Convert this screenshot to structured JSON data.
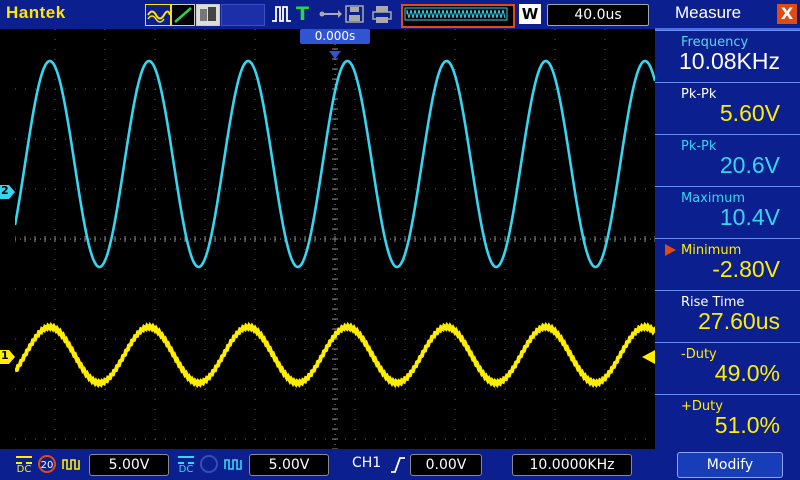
{
  "app": {
    "brand": "Hantek"
  },
  "toolbar": {
    "timebase": "40.0us",
    "w_label": "W",
    "trigger_position": "0.000s",
    "icons": [
      "waveform-mode-icon",
      "line-mode-icon",
      "persistence-icon",
      "trigger-pulse-icon",
      "trigger-mode-icon",
      "usb-icon",
      "save-icon",
      "print-icon",
      "memory-depth-icon"
    ]
  },
  "channels": {
    "ch1": {
      "marker": "1",
      "coupling": "DC",
      "bw": "20",
      "volts_div": "5.00V",
      "color": "#ffee00"
    },
    "ch2": {
      "marker": "2",
      "coupling": "DC",
      "volts_div": "5.00V",
      "color": "#35d6f2"
    }
  },
  "trigger": {
    "source": "CH1",
    "edge": "rising",
    "level": "0.00V"
  },
  "frequency_counter": "10.0000KHz",
  "panel": {
    "title": "Measure",
    "close_label": "X",
    "modify_label": "Modify",
    "items": [
      {
        "label": "Frequency",
        "value": "10.08KHz",
        "value_color": "#ffffff",
        "label_color": "#5ad5f5"
      },
      {
        "label": "Pk-Pk",
        "value": "5.60V",
        "value_color": "#ffee00",
        "label_color": "#ffffff"
      },
      {
        "label": "Pk-Pk",
        "value": "20.6V",
        "value_color": "#35d6f2",
        "label_color": "#35d6f2"
      },
      {
        "label": "Maximum",
        "value": "10.4V",
        "value_color": "#35d6f2",
        "label_color": "#35d6f2"
      },
      {
        "label": "Minimum",
        "value": "-2.80V",
        "value_color": "#ffee00",
        "label_color": "#ffee00",
        "selected": true
      },
      {
        "label": "Rise Time",
        "value": "27.60us",
        "value_color": "#ffee00",
        "label_color": "#ffffff"
      },
      {
        "label": "-Duty",
        "value": "49.0%",
        "value_color": "#ffee00",
        "label_color": "#ffee00"
      },
      {
        "label": "+Duty",
        "value": "51.0%",
        "value_color": "#ffee00",
        "label_color": "#ffee00"
      }
    ]
  },
  "colors": {
    "bar": "#0b1f8f",
    "accent": "#e14b12",
    "grid": "#6e6e6e"
  }
}
